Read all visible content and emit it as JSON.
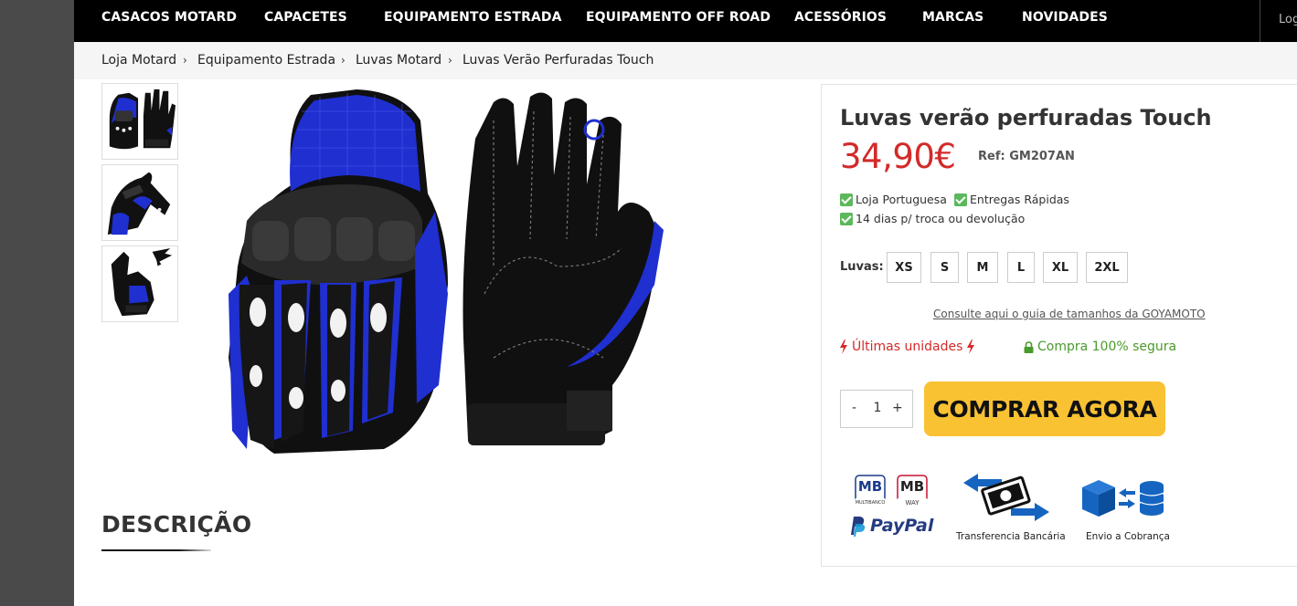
{
  "nav": {
    "items": [
      {
        "label": "CASACOS MOTARD"
      },
      {
        "label": "CAPACETES"
      },
      {
        "label": "EQUIPAMENTO ESTRADA"
      },
      {
        "label": "EQUIPAMENTO OFF ROAD"
      },
      {
        "label": "ACESSÓRIOS"
      },
      {
        "label": "MARCAS"
      },
      {
        "label": "NOVIDADES"
      }
    ],
    "login_label": "Log"
  },
  "breadcrumb": {
    "items": [
      {
        "label": "Loja Motard"
      },
      {
        "label": "Equipamento Estrada"
      },
      {
        "label": "Luvas Motard"
      },
      {
        "label": "Luvas Verão Perfuradas Touch"
      }
    ],
    "separator": "›"
  },
  "gallery": {
    "thumbnails": [
      "glove-pair-thumb",
      "glove-side-thumb",
      "glove-hand-thumb"
    ],
    "main_image": "blue-black-glove-pair-image"
  },
  "description": {
    "title": "DESCRIÇÃO"
  },
  "product": {
    "title": "Luvas verão perfuradas Touch",
    "price": "34,90€",
    "ref": "Ref: GM207AN",
    "perks": [
      "Loja Portuguesa",
      "Entregas Rápidas",
      "14 dias p/ troca ou devolução"
    ],
    "size_label": "Luvas:",
    "sizes": [
      "XS",
      "S",
      "M",
      "L",
      "XL",
      "2XL"
    ],
    "size_guide_link": "Consulte aqui o guia de tamanhos da GOYAMOTO",
    "last_units": "Últimas unidades",
    "secure": "Compra 100% segura",
    "quantity": {
      "minus": "-",
      "value": "1",
      "plus": "+"
    },
    "buy_button": "COMPRAR AGORA"
  },
  "payment": {
    "mb_multibanco": "MB",
    "mb_multibanco_sub": "MULTIBANCO",
    "mb_way": "MB",
    "mb_way_sub": "WAY",
    "paypal": "PayPal",
    "transfer_caption": "Transferencia Bancária",
    "cod_caption": "Envio a Cobrança"
  },
  "colors": {
    "price": "#d32a2a",
    "buy_button": "#f9c232",
    "secure": "#4a9a2c",
    "check": "#5cb85c",
    "glove_blue": "#1f2fd0",
    "paypal_dark": "#253b80",
    "paypal_light": "#179bd7",
    "mb_red": "#c8102e",
    "icon_blue": "#1565c0"
  }
}
